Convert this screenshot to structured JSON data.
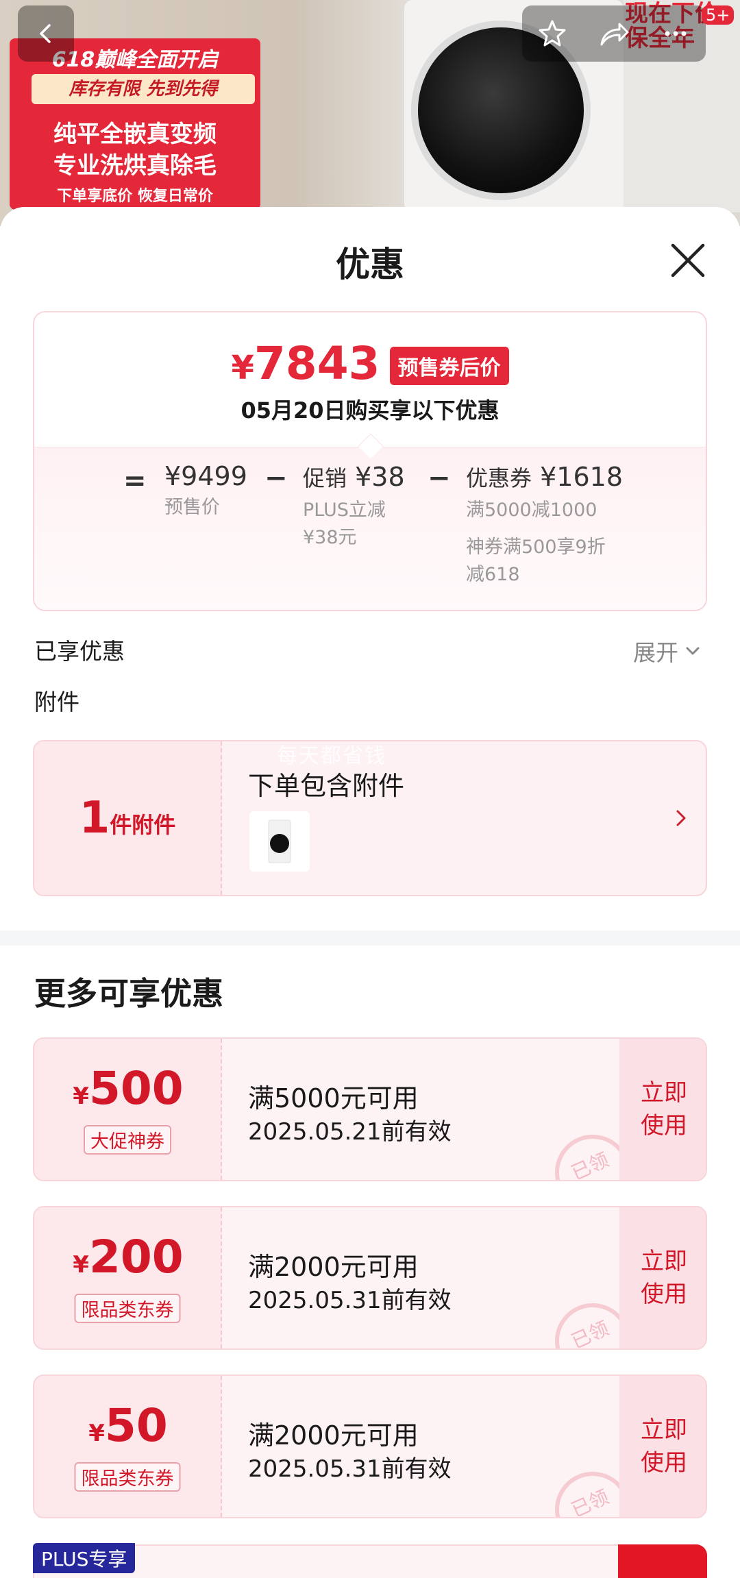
{
  "backdrop": {
    "promo_line1": "618巅峰全面开启",
    "promo_strip": "库存有限 先到先得",
    "promo_big1": "纯平全嵌真变频",
    "promo_big2": "专业洗烘真除毛",
    "promo_bottom": "下单享底价   恢复日常价",
    "corner_text": "现在下价保全年",
    "corner_count": "5+"
  },
  "header": {
    "title": "优惠"
  },
  "price_card": {
    "currency": "¥",
    "final_price": "7843",
    "final_tag": "预售券后价",
    "date_text": "05月20日购买享以下优惠",
    "equals": "=",
    "presale_price": "¥9499",
    "presale_label": "预售价",
    "minus1": "−",
    "promo_label": "促销",
    "promo_amount": "¥38",
    "promo_sub1": "PLUS立减",
    "promo_sub2": "¥38元",
    "minus2": "−",
    "coupon_label": "优惠券",
    "coupon_amount": "¥1618",
    "coupon_sub1": "满5000减1000",
    "coupon_sub2": "神券满500享9折",
    "coupon_sub3": "减618"
  },
  "enjoyed": {
    "label": "已享优惠",
    "expand": "展开"
  },
  "attachments": {
    "section_label": "附件",
    "count": "1",
    "unit": "件附件",
    "title": "下单包含附件",
    "watermark": "每天都省钱"
  },
  "more": {
    "title": "更多可享优惠"
  },
  "coupons": [
    {
      "currency": "¥",
      "amount": "500",
      "tag": "大促神券",
      "condition": "满5000元可用",
      "validity": "2025.05.21前有效",
      "action_line1": "立即",
      "action_line2": "使用",
      "stamp": "已领"
    },
    {
      "currency": "¥",
      "amount": "200",
      "tag": "限品类东券",
      "condition": "满2000元可用",
      "validity": "2025.05.31前有效",
      "action_line1": "立即",
      "action_line2": "使用",
      "stamp": "已领"
    },
    {
      "currency": "¥",
      "amount": "50",
      "tag": "限品类东券",
      "condition": "满2000元可用",
      "validity": "2025.05.31前有效",
      "action_line1": "立即",
      "action_line2": "使用",
      "stamp": "已领"
    }
  ],
  "plus_section": {
    "tag": "PLUS专享"
  },
  "colors": {
    "accent_red": "#e4283a",
    "coupon_bg": "#fdf2f4",
    "plus_blue": "#26279a"
  },
  "icons": [
    "chevron-left-icon",
    "star-icon",
    "share-icon",
    "more-icon",
    "close-icon",
    "chevron-down-icon",
    "chevron-right-icon"
  ]
}
